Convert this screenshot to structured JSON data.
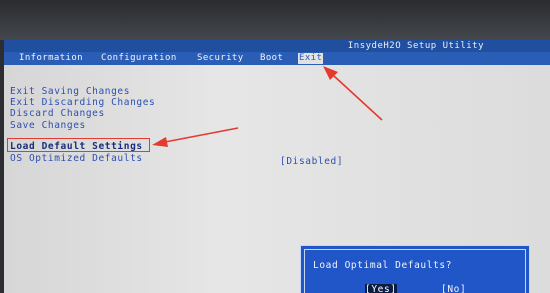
{
  "title": "InsydeH2O Setup Utility",
  "menu": {
    "items": [
      {
        "label": "Information"
      },
      {
        "label": "Configuration"
      },
      {
        "label": "Security"
      },
      {
        "label": "Boot"
      },
      {
        "label": "Exit",
        "active": true
      }
    ]
  },
  "options": [
    {
      "label": "Exit Saving Changes"
    },
    {
      "label": "Exit Discarding Changes"
    },
    {
      "label": "Discard Changes"
    },
    {
      "label": "Save Changes"
    },
    {
      "label": "Load Default Settings",
      "selected": true
    },
    {
      "label": "OS Optimized Defaults",
      "value": "[Disabled]"
    }
  ],
  "dialog": {
    "title": "Load Optimal Defaults?",
    "yes_label": "[Yes]",
    "no_label": "[No]",
    "focused": "yes"
  },
  "colors": {
    "menu_bar": "#2a5db5",
    "option_text": "#2d4fb0",
    "annotation": "#e43a2f",
    "dialog_bg": "#2056c8"
  }
}
